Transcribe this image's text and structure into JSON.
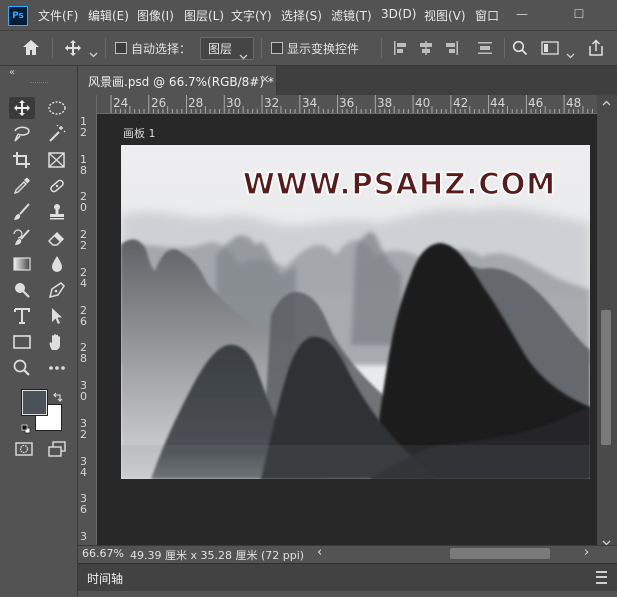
{
  "app": {
    "logo_text": "Ps"
  },
  "menu": [
    "文件(F)",
    "编辑(E)",
    "图像(I)",
    "图层(L)",
    "文字(Y)",
    "选择(S)",
    "滤镜(T)",
    "3D(D)",
    "视图(V)",
    "窗口"
  ],
  "window_controls": [
    "—",
    "☐"
  ],
  "options_bar": {
    "auto_select_label": "自动选择：",
    "auto_select_value": "图层",
    "show_transform_label": "显示变换控件"
  },
  "document": {
    "tab_title": "风景画.psd @ 66.7%(RGB/8#) *",
    "close_symbol": "×",
    "artboard_label": "画板 1",
    "watermark": "WWW.PSAHZ.COM"
  },
  "ruler": {
    "h_labels": [
      "24",
      "26",
      "28",
      "30",
      "32",
      "34",
      "36",
      "38",
      "40",
      "42",
      "44",
      "46",
      "48"
    ],
    "v_labels": [
      [
        "1",
        "2"
      ],
      [
        "1",
        "8"
      ],
      [
        "2",
        "0"
      ],
      [
        "2",
        "2"
      ],
      [
        "2",
        "4"
      ],
      [
        "2",
        "6"
      ],
      [
        "2",
        "8"
      ],
      [
        "3",
        "0"
      ],
      [
        "3",
        "2"
      ],
      [
        "3",
        "4"
      ],
      [
        "3",
        "6"
      ],
      [
        "3"
      ]
    ]
  },
  "status": {
    "zoom": "66.67%",
    "doc_size": "49.39 厘米 x 35.28 厘米 (72 ppi)",
    "arrow_left": "‹",
    "arrow_right": "›"
  },
  "panels": {
    "timeline_title": "时间轴"
  },
  "colors": {
    "foreground": "#4a5158",
    "background": "#ffffff",
    "accent": "#31a8ff"
  },
  "icons": [
    "ps-logo-icon",
    "home-icon",
    "move-icon",
    "chevron-down-icon",
    "align-left-icon",
    "align-center-icon",
    "align-right-icon",
    "distribute-icon",
    "search-icon",
    "workspace-icon",
    "share-icon",
    "move-tool-icon",
    "marquee-icon",
    "lasso-icon",
    "magic-wand-icon",
    "crop-icon",
    "frame-icon",
    "eyedropper-icon",
    "healing-icon",
    "brush-icon",
    "stamp-icon",
    "history-brush-icon",
    "eraser-icon",
    "gradient-icon",
    "blur-icon",
    "dodge-icon",
    "pen-icon",
    "type-icon",
    "path-select-icon",
    "rectangle-icon",
    "hand-icon",
    "zoom-icon",
    "more-icon",
    "quick-mask-icon",
    "screen-mode-icon"
  ]
}
